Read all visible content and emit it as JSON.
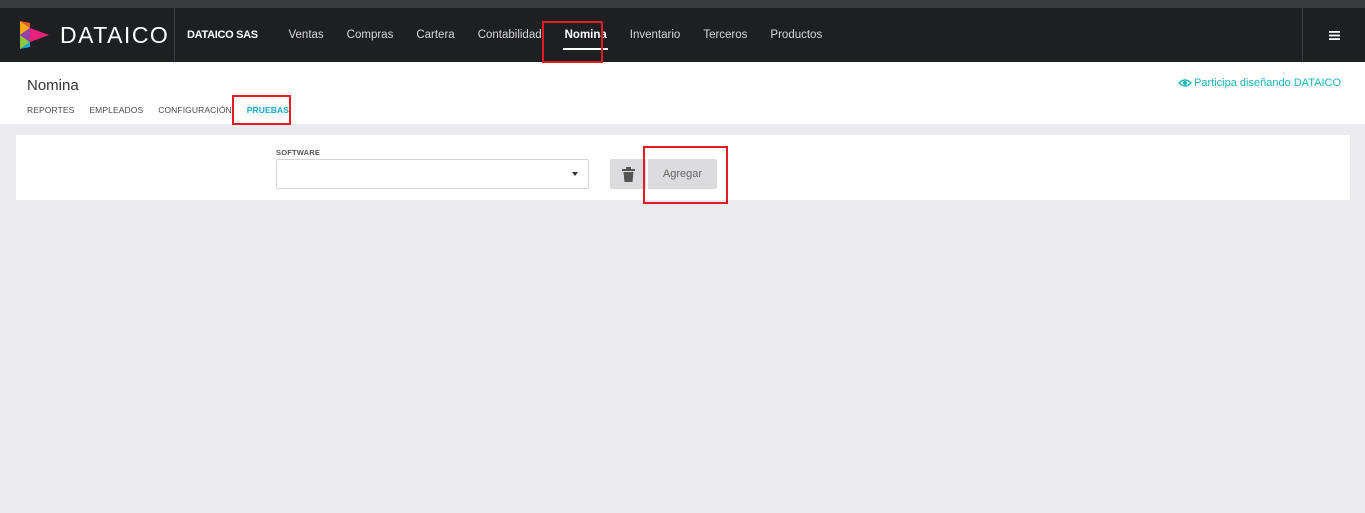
{
  "brand": {
    "name": "DATAICO"
  },
  "company": "DATAICO SAS",
  "menu": [
    {
      "label": "Ventas"
    },
    {
      "label": "Compras"
    },
    {
      "label": "Cartera"
    },
    {
      "label": "Contabilidad"
    },
    {
      "label": "Nomina",
      "active": true
    },
    {
      "label": "Inventario"
    },
    {
      "label": "Terceros"
    },
    {
      "label": "Productos"
    }
  ],
  "page": {
    "title": "Nomina",
    "feedback_link": "Participa diseñando DATAICO",
    "tabs": [
      {
        "label": "REPORTES"
      },
      {
        "label": "EMPLEADOS"
      },
      {
        "label": "CONFIGURACIÓN"
      },
      {
        "label": "PRUEBAS",
        "active": true
      }
    ]
  },
  "form": {
    "software_label": "SOFTWARE",
    "software_value": "",
    "add_button": "Agregar"
  },
  "colors": {
    "nav_bg": "#1e1f21",
    "accent": "#15a9c9",
    "feedback": "#1bb5b8",
    "highlight": "#e31b23"
  },
  "icons": [
    "brand-logo-icon",
    "menu-icon",
    "feedback-icon",
    "trash-icon",
    "caret-down-icon"
  ]
}
